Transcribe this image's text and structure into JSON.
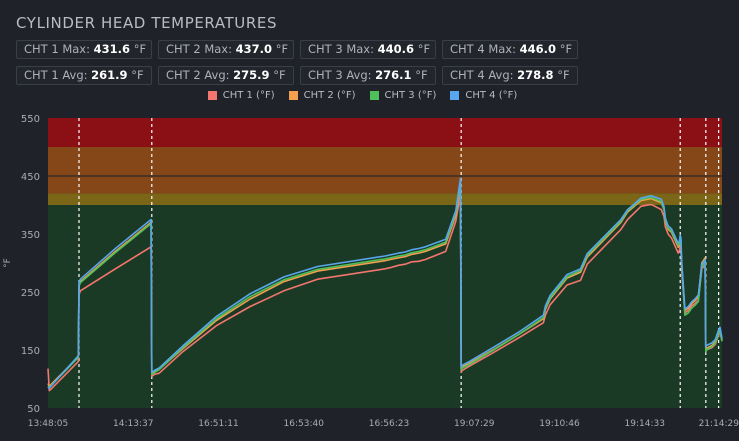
{
  "title": "CYLINDER HEAD TEMPERATURES",
  "stats": {
    "max": [
      {
        "label": "CHT 1 Max:",
        "value": "431.6",
        "unit": "°F"
      },
      {
        "label": "CHT 2 Max:",
        "value": "437.0",
        "unit": "°F"
      },
      {
        "label": "CHT 3 Max:",
        "value": "440.6",
        "unit": "°F"
      },
      {
        "label": "CHT 4 Max:",
        "value": "446.0",
        "unit": "°F"
      }
    ],
    "avg": [
      {
        "label": "CHT 1 Avg:",
        "value": "261.9",
        "unit": "°F"
      },
      {
        "label": "CHT 2 Avg:",
        "value": "275.9",
        "unit": "°F"
      },
      {
        "label": "CHT 3 Avg:",
        "value": "276.1",
        "unit": "°F"
      },
      {
        "label": "CHT 4 Avg:",
        "value": "278.8",
        "unit": "°F"
      }
    ]
  },
  "chart_data": {
    "type": "line",
    "ylabel": "°F",
    "ylim": [
      50,
      550
    ],
    "yticks": [
      50,
      150,
      250,
      350,
      450,
      550
    ],
    "xlim": [
      "13:48:05",
      "21:14:29"
    ],
    "xticks": [
      "13:48:05",
      "14:13:37",
      "16:51:11",
      "16:53:40",
      "16:56:23",
      "19:07:29",
      "19:10:46",
      "19:14:33",
      "21:14:29"
    ],
    "x_index_range": [
      0,
      1000
    ],
    "bands": [
      {
        "from": 500,
        "to": 550,
        "color": "#8b1016"
      },
      {
        "from": 420,
        "to": 500,
        "color": "#864718"
      },
      {
        "from": 400,
        "to": 420,
        "color": "#7b6516"
      },
      {
        "from": 50,
        "to": 400,
        "color": "#1b3a25"
      }
    ],
    "reference_lines": [
      {
        "y": 450,
        "color": "#2a2a2a"
      }
    ],
    "session_breaks": [
      46,
      154,
      613,
      938,
      976,
      995
    ],
    "series": [
      {
        "name": "CHT 1 (°F)",
        "color": "#f4766e",
        "x": [
          0,
          2,
          4,
          45,
          46,
          48,
          100,
          153,
          154,
          156,
          158,
          165,
          200,
          250,
          300,
          350,
          400,
          500,
          508,
          520,
          530,
          540,
          550,
          560,
          590,
          605,
          612,
          613,
          615,
          625,
          660,
          700,
          735,
          738,
          745,
          770,
          790,
          800,
          850,
          860,
          880,
          895,
          910,
          914,
          916,
          920,
          925,
          935,
          937,
          938,
          939,
          940,
          945,
          950,
          955,
          960,
          965,
          970,
          975,
          976,
          977,
          985,
          990,
          995,
          997,
          1000
        ],
        "values": [
          118,
          80,
          82,
          130,
          245,
          252,
          290,
          328,
          105,
          106,
          108,
          110,
          147,
          192,
          225,
          252,
          272,
          290,
          292,
          296,
          298,
          302,
          303,
          306,
          320,
          372,
          420,
          112,
          115,
          122,
          145,
          172,
          197,
          210,
          228,
          262,
          270,
          298,
          358,
          375,
          398,
          401,
          392,
          380,
          362,
          350,
          343,
          317,
          322,
          330,
          326,
          290,
          214,
          218,
          226,
          230,
          236,
          290,
          296,
          147,
          150,
          154,
          160,
          176,
          180,
          166
        ]
      },
      {
        "name": "CHT 2 (°F)",
        "color": "#f3a04f",
        "x": [
          0,
          2,
          4,
          45,
          46,
          48,
          100,
          153,
          154,
          156,
          158,
          165,
          200,
          250,
          300,
          350,
          400,
          500,
          508,
          520,
          530,
          540,
          550,
          560,
          590,
          605,
          612,
          613,
          615,
          625,
          660,
          700,
          735,
          738,
          745,
          770,
          790,
          800,
          850,
          860,
          880,
          895,
          910,
          914,
          916,
          920,
          925,
          935,
          937,
          938,
          939,
          940,
          945,
          950,
          955,
          960,
          965,
          970,
          975,
          976,
          977,
          985,
          990,
          995,
          997,
          1000
        ],
        "values": [
          92,
          87,
          90,
          138,
          262,
          268,
          320,
          370,
          110,
          111,
          112,
          117,
          152,
          201,
          238,
          268,
          286,
          304,
          306,
          309,
          311,
          315,
          317,
          320,
          333,
          382,
          437,
          118,
          121,
          127,
          150,
          178,
          204,
          220,
          238,
          274,
          284,
          310,
          370,
          388,
          408,
          411,
          404,
          392,
          372,
          358,
          353,
          327,
          332,
          340,
          336,
          298,
          218,
          222,
          230,
          235,
          242,
          300,
          309,
          150,
          153,
          158,
          164,
          181,
          185,
          168
        ]
      },
      {
        "name": "CHT 3 (°F)",
        "color": "#4fbf59",
        "x": [
          0,
          2,
          4,
          45,
          46,
          48,
          100,
          153,
          154,
          156,
          158,
          165,
          200,
          250,
          300,
          350,
          400,
          500,
          508,
          520,
          530,
          540,
          550,
          560,
          590,
          605,
          612,
          613,
          615,
          625,
          660,
          700,
          735,
          738,
          745,
          770,
          790,
          800,
          850,
          860,
          880,
          895,
          910,
          914,
          916,
          920,
          925,
          935,
          937,
          938,
          939,
          940,
          945,
          950,
          955,
          960,
          965,
          970,
          975,
          976,
          977,
          985,
          990,
          995,
          997,
          1000
        ],
        "values": [
          88,
          85,
          88,
          137,
          260,
          266,
          318,
          368,
          108,
          109,
          111,
          116,
          154,
          204,
          242,
          271,
          289,
          307,
          309,
          312,
          314,
          318,
          320,
          323,
          336,
          386,
          441,
          116,
          119,
          125,
          149,
          178,
          206,
          222,
          240,
          276,
          287,
          313,
          372,
          390,
          410,
          413,
          406,
          393,
          373,
          360,
          355,
          330,
          335,
          344,
          340,
          302,
          210,
          214,
          222,
          227,
          234,
          292,
          302,
          147,
          150,
          156,
          162,
          179,
          183,
          165
        ]
      },
      {
        "name": "CHT 4 (°F)",
        "color": "#58a6ee",
        "x": [
          0,
          2,
          4,
          45,
          46,
          48,
          100,
          153,
          154,
          156,
          158,
          165,
          200,
          250,
          300,
          350,
          400,
          500,
          508,
          520,
          530,
          540,
          550,
          560,
          590,
          605,
          612,
          613,
          615,
          625,
          660,
          700,
          735,
          738,
          745,
          770,
          790,
          800,
          850,
          860,
          880,
          895,
          910,
          914,
          916,
          920,
          925,
          935,
          937,
          938,
          939,
          940,
          945,
          950,
          955,
          960,
          965,
          970,
          975,
          976,
          977,
          985,
          990,
          995,
          997,
          1000
        ],
        "values": [
          86,
          84,
          87,
          140,
          266,
          272,
          325,
          375,
          112,
          113,
          115,
          119,
          157,
          208,
          247,
          276,
          294,
          312,
          314,
          317,
          319,
          323,
          325,
          328,
          341,
          390,
          446,
          121,
          124,
          130,
          154,
          182,
          210,
          226,
          244,
          280,
          290,
          316,
          375,
          392,
          412,
          416,
          410,
          397,
          377,
          364,
          359,
          334,
          339,
          348,
          344,
          306,
          221,
          225,
          233,
          238,
          245,
          297,
          306,
          155,
          158,
          162,
          168,
          185,
          189,
          170
        ]
      }
    ]
  }
}
